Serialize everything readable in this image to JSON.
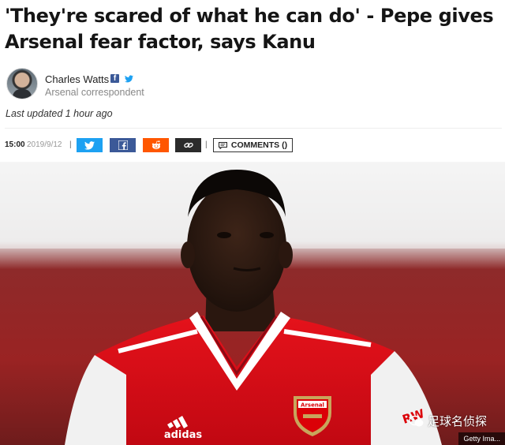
{
  "article": {
    "headline": "'They're scared of what he can do' - Pepe gives Arsenal fear factor, says Kanu",
    "author": {
      "name": "Charles Watts",
      "role": "Arsenal correspondent"
    },
    "last_updated": "Last updated 1 hour ago",
    "time": "15:00",
    "date": "2019/9/12",
    "comments_label": "COMMENTS ()"
  },
  "photo": {
    "credit": "Getty Ima...",
    "kit_brand": "adidas",
    "crest_text": "Arsenal",
    "sponsor": "RW"
  },
  "watermark": {
    "text": "足球名侦探"
  },
  "colors": {
    "twitter": "#1da1f2",
    "facebook": "#3b5998",
    "reddit": "#ff5700",
    "link": "#2b2b2b",
    "arsenal_red": "#db0007"
  },
  "icons": [
    "facebook-icon",
    "twitter-icon",
    "reddit-icon",
    "link-icon",
    "comment-icon",
    "wechat-icon"
  ]
}
